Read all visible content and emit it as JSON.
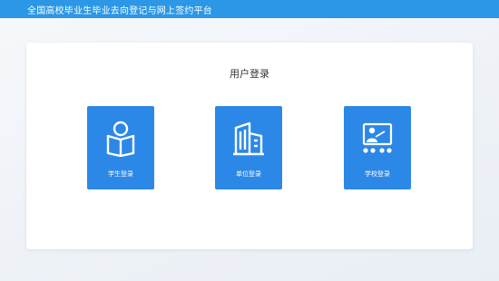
{
  "header": {
    "title": "全国高校毕业生毕业去向登记与网上签约平台"
  },
  "login": {
    "title": "用户登录",
    "options": [
      {
        "label": "学生登录",
        "icon": "student-reading-icon"
      },
      {
        "label": "单位登录",
        "icon": "building-icon"
      },
      {
        "label": "学校登录",
        "icon": "teacher-board-icon"
      }
    ]
  },
  "colors": {
    "header_bg": "#2b97e6",
    "card_bg": "#2c88e7",
    "panel_bg": "#ffffff",
    "page_bg": "#eef2f7"
  }
}
